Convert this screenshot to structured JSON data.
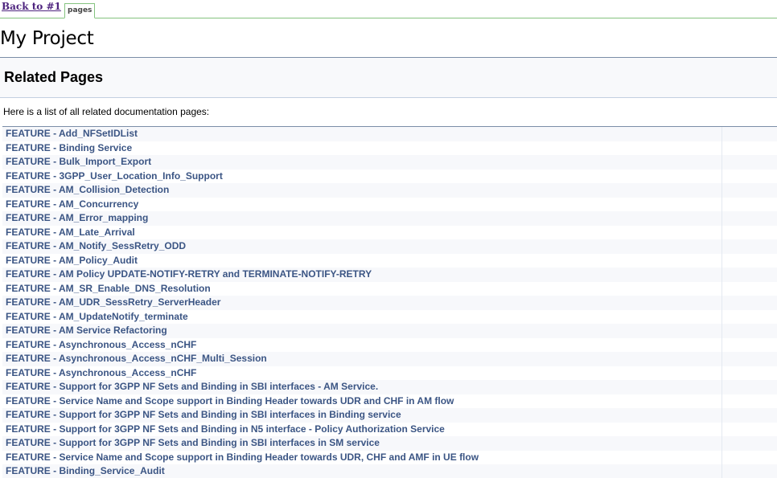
{
  "nav": {
    "back_label": "Back to #1",
    "tab_label": "pages"
  },
  "project_title": "My Project",
  "page_heading": "Related Pages",
  "intro_text": "Here is a list of all related documentation pages:",
  "pages": [
    "FEATURE - Add_NFSetIDList",
    "FEATURE - Binding Service",
    "FEATURE - Bulk_Import_Export",
    "FEATURE - 3GPP_User_Location_Info_Support",
    "FEATURE - AM_Collision_Detection",
    "FEATURE - AM_Concurrency",
    "FEATURE - AM_Error_mapping",
    "FEATURE - AM_Late_Arrival",
    "FEATURE - AM_Notify_SessRetry_ODD",
    "FEATURE - AM_Policy_Audit",
    "FEATURE - AM Policy UPDATE-NOTIFY-RETRY and TERMINATE-NOTIFY-RETRY",
    "FEATURE - AM_SR_Enable_DNS_Resolution",
    "FEATURE - AM_UDR_SessRetry_ServerHeader",
    "FEATURE - AM_UpdateNotify_terminate",
    "FEATURE - AM Service Refactoring",
    "FEATURE - Asynchronous_Access_nCHF",
    "FEATURE - Asynchronous_Access_nCHF_Multi_Session",
    "FEATURE - Asynchronous_Access_nCHF",
    "FEATURE - Support for 3GPP NF Sets and Binding in SBI interfaces - AM Service.",
    "FEATURE - Service Name and Scope support in Binding Header towards UDR and CHF in AM flow",
    "FEATURE - Support for 3GPP NF Sets and Binding in SBI interfaces in Binding service",
    "FEATURE - Support for 3GPP NF Sets and Binding in N5 interface - Policy Authorization Service",
    "FEATURE - Support for 3GPP NF Sets and Binding in SBI interfaces in SM service",
    "FEATURE - Service Name and Scope support in Binding Header towards UDR, CHF and AMF in UE flow",
    "FEATURE - Binding_Service_Audit"
  ],
  "colors": {
    "link": "#3b5584",
    "nav_border": "#84c37f",
    "back_link": "#4d237e"
  }
}
